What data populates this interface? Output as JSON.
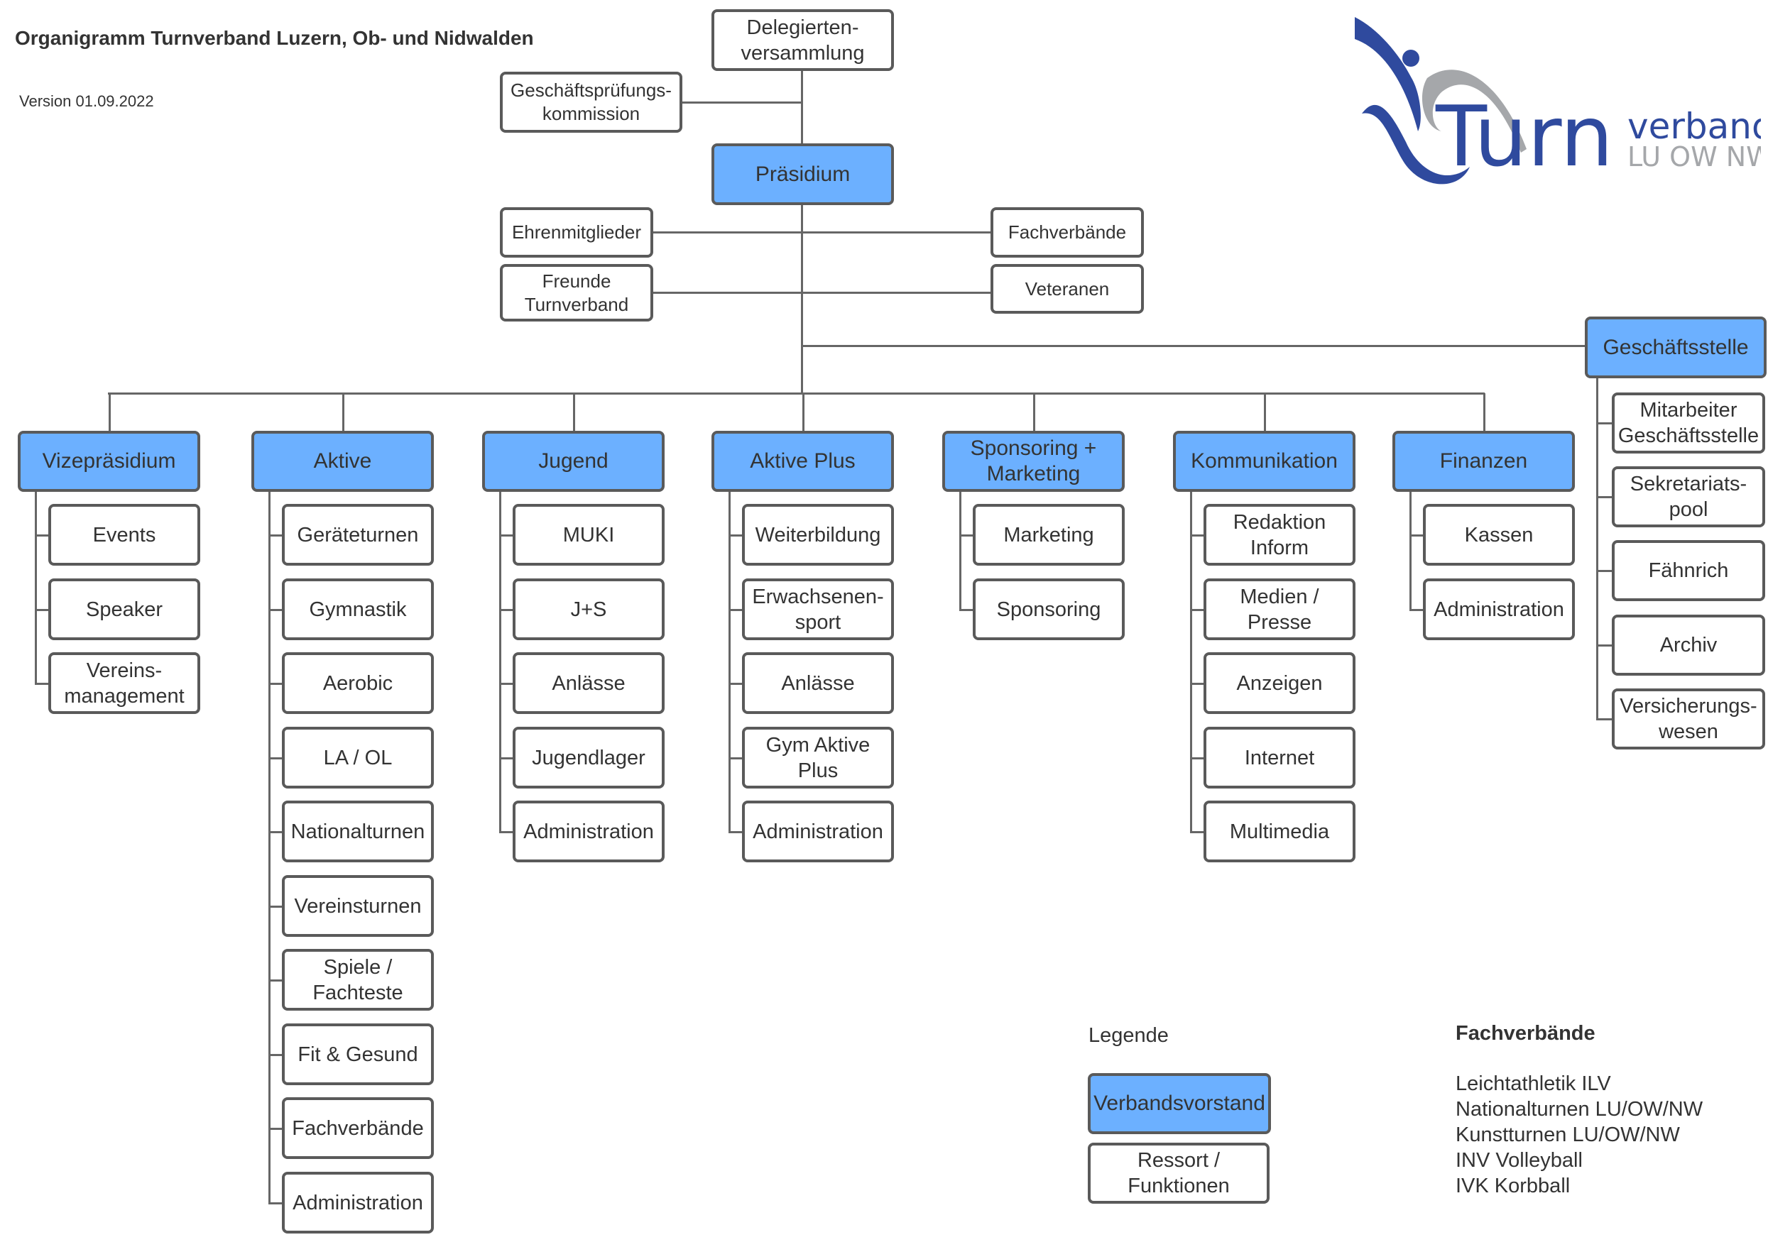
{
  "header": {
    "title": "Organigramm Turnverband Luzern, Ob- und Nidwalden",
    "version": "Version 01.09.2022"
  },
  "logo": {
    "word_main": "Turn",
    "word_top": "verband",
    "word_bottom": "LU OW NW",
    "colors": {
      "blue": "#2f4a9e",
      "gray": "#a5a7aa"
    }
  },
  "colors": {
    "vorstand_fill": "#6cb0ff",
    "border": "#5a5a5a",
    "line": "#666666"
  },
  "top": {
    "delegierten": "Delegierten-\nversammlung",
    "gpk": "Geschäftsprüfungs-\nkommission",
    "praesidium": "Präsidium",
    "ehrenmitglieder": "Ehrenmitglieder",
    "freunde": "Freunde\nTurnverband",
    "fachverbaende": "Fachverbände",
    "veteranen": "Veteranen"
  },
  "geschaeftsstelle": {
    "label": "Geschäftsstelle",
    "children": [
      "Mitarbeiter\nGeschäftsstelle",
      "Sekretariats-\npool",
      "Fähnrich",
      "Archiv",
      "Versicherungs-\nwesen"
    ]
  },
  "ressorts": [
    {
      "label": "Vizepräsidium",
      "children": [
        "Events",
        "Speaker",
        "Vereins-\nmanagement"
      ]
    },
    {
      "label": "Aktive",
      "children": [
        "Geräteturnen",
        "Gymnastik",
        "Aerobic",
        "LA / OL",
        "Nationalturnen",
        "Vereinsturnen",
        "Spiele /\nFachteste",
        "Fit & Gesund",
        "Fachverbände",
        "Administration"
      ]
    },
    {
      "label": "Jugend",
      "children": [
        "MUKI",
        "J+S",
        "Anlässe",
        "Jugendlager",
        "Administration"
      ]
    },
    {
      "label": "Aktive Plus",
      "children": [
        "Weiterbildung",
        "Erwachsenen-\nsport",
        "Anlässe",
        "Gym Aktive\nPlus",
        "Administration"
      ]
    },
    {
      "label": "Sponsoring +\nMarketing",
      "children": [
        "Marketing",
        "Sponsoring"
      ]
    },
    {
      "label": "Kommunikation",
      "children": [
        "Redaktion\nInform",
        "Medien /\nPresse",
        "Anzeigen",
        "Internet",
        "Multimedia"
      ]
    },
    {
      "label": "Finanzen",
      "children": [
        "Kassen",
        "Administration"
      ]
    }
  ],
  "legend": {
    "title": "Legende",
    "vorstand": "Verbandsvorstand",
    "ressort": "Ressort /\nFunktionen"
  },
  "fachverbaende_list": {
    "title": "Fachverbände",
    "items": [
      "Leichtathletik ILV",
      "Nationalturnen LU/OW/NW",
      "Kunstturnen LU/OW/NW",
      "INV Volleyball",
      "IVK Korbball"
    ]
  }
}
